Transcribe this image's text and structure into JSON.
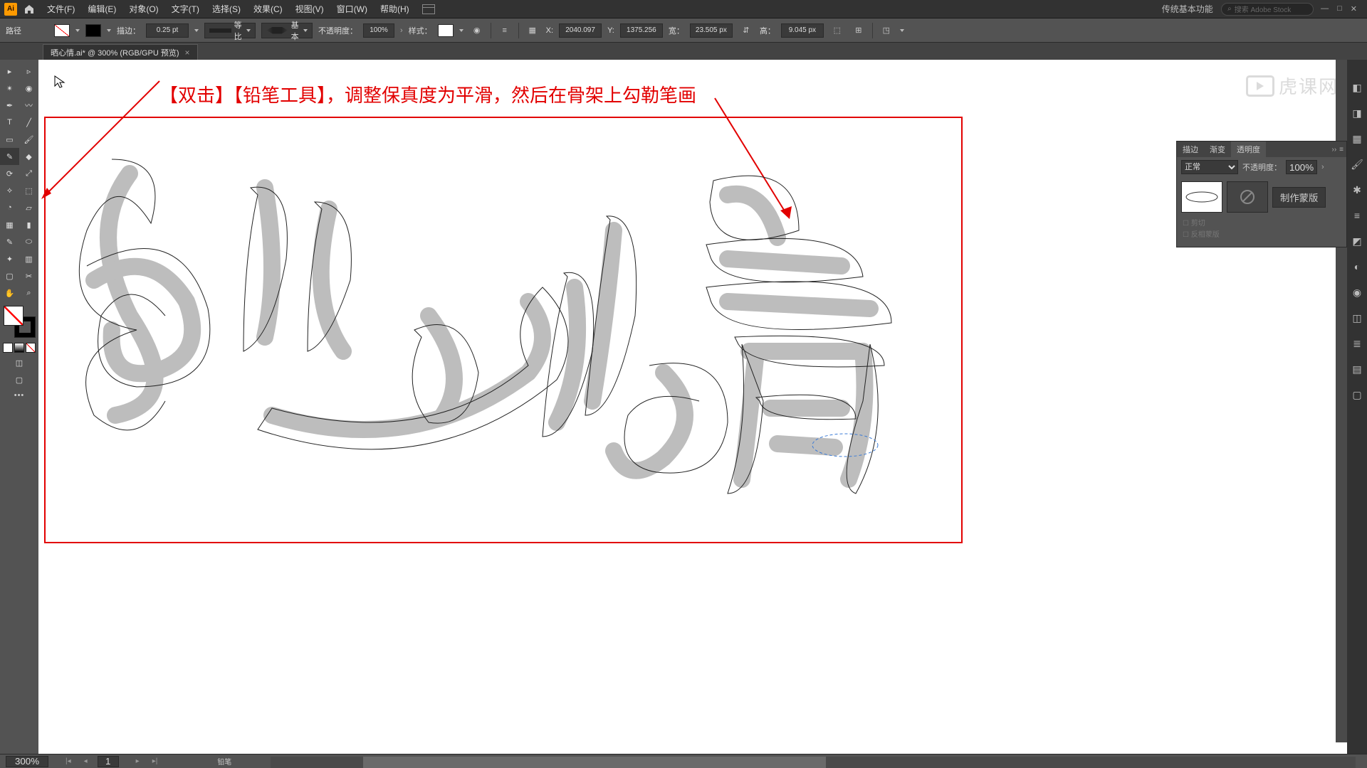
{
  "menu": {
    "app_initials": "Ai",
    "items": [
      "文件(F)",
      "编辑(E)",
      "对象(O)",
      "文字(T)",
      "选择(S)",
      "效果(C)",
      "视图(V)",
      "窗口(W)",
      "帮助(H)"
    ],
    "workspace": "传统基本功能",
    "search_placeholder": "搜索 Adobe Stock"
  },
  "control": {
    "selection_label": "路径",
    "stroke_label": "描边：",
    "stroke_weight": "0.25 pt",
    "profile_equal": "等比",
    "profile_basic": "基本",
    "opacity_label": "不透明度：",
    "opacity_value": "100%",
    "style_label": "样式：",
    "x_label": "X:",
    "y_label": "Y:",
    "w_label": "宽：",
    "h_label": "高：",
    "x": "2040.097",
    "y": "1375.256",
    "w": "23.505 px",
    "h": "9.045 px"
  },
  "tab": {
    "title": "晒心情.ai* @ 300% (RGB/GPU 预览)"
  },
  "annotation": "【双击】【铅笔工具】，调整保真度为平滑，然后在骨架上勾勒笔画",
  "transparency": {
    "tab_stroke": "描边",
    "tab_gradient": "渐变",
    "tab_transparency": "透明度",
    "blend_mode": "正常",
    "opacity_label": "不透明度：",
    "opacity_value": "100%",
    "make_mask": "制作蒙版",
    "clip": "剪切",
    "invert": "反相蒙版"
  },
  "status": {
    "zoom": "300%",
    "artboard_nav": "1",
    "tool_hint": "铅笔"
  },
  "watermark": "虎课网"
}
